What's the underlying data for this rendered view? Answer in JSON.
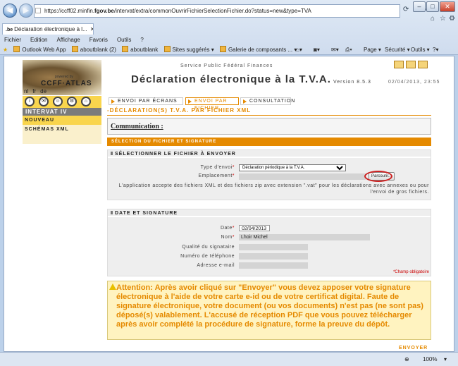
{
  "browser": {
    "address_prefix": "https://ccff02.minfin.",
    "address_domain": "fgov.be",
    "address_rest": "/intervat/extra/commonOuvrirFichierSelectionFichier.do?status=new&type=TVA",
    "tab_title": "Déclaration électronique à l...",
    "tab_favicon": ".be",
    "menu": [
      "Fichier",
      "Edition",
      "Affichage",
      "Favoris",
      "Outils",
      "?"
    ],
    "favorites": [
      {
        "label": "Outlook Web App",
        "icon": "outlook-icon"
      },
      {
        "label": "aboutblank (2)",
        "icon": "page-icon"
      },
      {
        "label": "aboutblank",
        "icon": "page-icon"
      },
      {
        "label": "Sites suggérés ▾",
        "icon": "ie-icon"
      },
      {
        "label": "Galerie de composants ... ▾",
        "icon": "gallery-icon"
      }
    ],
    "toolbar_right": [
      "Page ▾",
      "Sécurité ▾",
      "Outils ▾"
    ],
    "zoom": "100%"
  },
  "header": {
    "logo_text": "CCFF·ATLAS",
    "logo_caption": "powered by",
    "service": "Service Public Fédéral Finances",
    "title": "Déclaration électronique à la T.V.A.",
    "version": "Version 8.5.3",
    "datetime": "02/04/2013, 23:55",
    "languages": [
      "nl",
      "fr",
      "de"
    ]
  },
  "tabs": [
    {
      "label": "ENVOI PAR ÉCRANS",
      "active": false
    },
    {
      "label": "ENVOI PAR FICHIER",
      "active": true
    },
    {
      "label": "CONSULTATION",
      "active": false
    }
  ],
  "nav": {
    "heading": "INTERVAT IV",
    "items": [
      {
        "label": "NOUVEAU",
        "active": true
      },
      {
        "label": "SCHÉMAS XML",
        "active": false
      }
    ]
  },
  "content": {
    "title": "-DÉCLARATION(S) T.V.A. PAR FICHIER XML",
    "communication": "Communication :",
    "bar": "SÉLECTION DU FICHIER ET SIGNATURE",
    "file_section": {
      "heading": "SÉLECTIONNER LE FICHIER À ENVOYER",
      "type_label": "Type d'envoi",
      "type_value": "Déclaration périodique à la T.V.A.",
      "location_label": "Emplacement",
      "browse_label": "Parcourir...",
      "hint": "L'application accepte des fichiers XML et des fichiers zip avec extension \".vat\" pour les déclarations avec annexes ou pour l'envoi de gros fichiers."
    },
    "sign_section": {
      "heading": "DATE ET SIGNATURE",
      "date_label": "Date",
      "date_value": "02/04/2013",
      "name_label": "Nom",
      "name_value": "Lhoir Michel",
      "quality_label": "Qualité du signataire",
      "phone_label": "Numéro de téléphone",
      "email_label": "Adresse e-mail",
      "required_note": "*Champ obligatoire"
    },
    "warning": "Attention: Après avoir cliqué sur \"Envoyer\" vous devez apposer votre signature électronique à l'aide de votre carte e-id ou de votre certificat digital. Faute de signature électronique, votre document (ou vos documents) n'est pas (ne sont pas) déposé(s) valablement. L'accusé de réception PDF que vous pouvez télécharger après avoir complété la procédure de signature, forme la preuve du dépôt.",
    "send_button": "ENVOYER"
  }
}
